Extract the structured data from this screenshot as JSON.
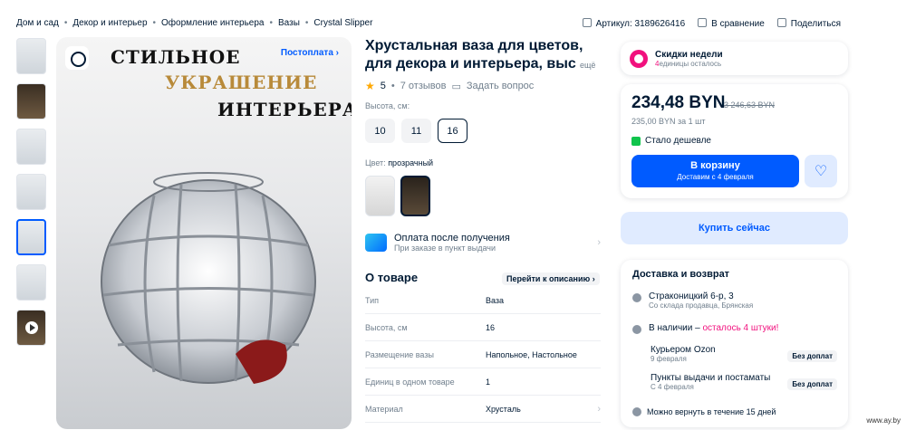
{
  "breadcrumbs": [
    "Дом и сад",
    "Декор и интерьер",
    "Оформление интерьера",
    "Вазы",
    "Crystal Slipper"
  ],
  "topbar": {
    "article": "Артикул: 3189626416",
    "compare": "В сравнение",
    "share": "Поделиться"
  },
  "image": {
    "line1": "СТИЛЬНОЕ",
    "line2": "УКРАШЕНИЕ",
    "line3": "ИНТЕРЬЕРА",
    "postpay": "Постоплата ›"
  },
  "product": {
    "title": "Хрустальная ваза для цветов, для декора и интерьера, выс",
    "more": "ещё",
    "rating": "5",
    "reviews": "7 отзывов",
    "ask": "Задать вопрос"
  },
  "height": {
    "label": "Высота, см:",
    "options": [
      "10",
      "11",
      "16"
    ],
    "selected": "16"
  },
  "color": {
    "label": "Цвет:",
    "value": "прозрачный"
  },
  "payment": {
    "title": "Оплата после получения",
    "subtitle": "При заказе в пункт выдачи"
  },
  "about": {
    "heading": "О товаре",
    "link": "Перейти к описанию ›",
    "specs": [
      {
        "k": "Тип",
        "v": "Ваза"
      },
      {
        "k": "Высота, см",
        "v": "16"
      },
      {
        "k": "Размещение вазы",
        "v": "Напольное, Настольное"
      },
      {
        "k": "Единиц в одном товаре",
        "v": "1"
      },
      {
        "k": "Материал",
        "v": "Хрусталь"
      }
    ]
  },
  "sale": {
    "title": "Скидки недели",
    "count": "4",
    "rest": "единицы осталось"
  },
  "price": {
    "current": "234,48 BYN",
    "old": "3 246,63 BYN",
    "unit": "235,00 BYN за 1 шт",
    "cheaper": "Стало дешевле",
    "cart": "В корзину",
    "cart_sub": "Доставим с 4 февраля",
    "fav": "♡"
  },
  "buy_now": "Купить сейчас",
  "delivery": {
    "heading": "Доставка и возврат",
    "address": "Страконицкий 6-р, 3",
    "address_sub": "Со склада продавца, Брянская",
    "stock": "В наличии",
    "stock_dash": " – ",
    "stock_warn": "осталось 4 штуки!",
    "courier": "Курьером Ozon",
    "courier_date": "9 февраля",
    "courier_tag": "Без доплат",
    "pickup": "Пункты выдачи и постаматы",
    "pickup_date": "С 4 февраля",
    "pickup_tag": "Без доплат",
    "return": "Можно вернуть в течение 15 дней"
  },
  "watermark": "www.ay.by",
  "colors": {
    "accent": "#005bff",
    "pink": "#f1117e",
    "text": "#001a34",
    "muted": "#707f8d"
  }
}
